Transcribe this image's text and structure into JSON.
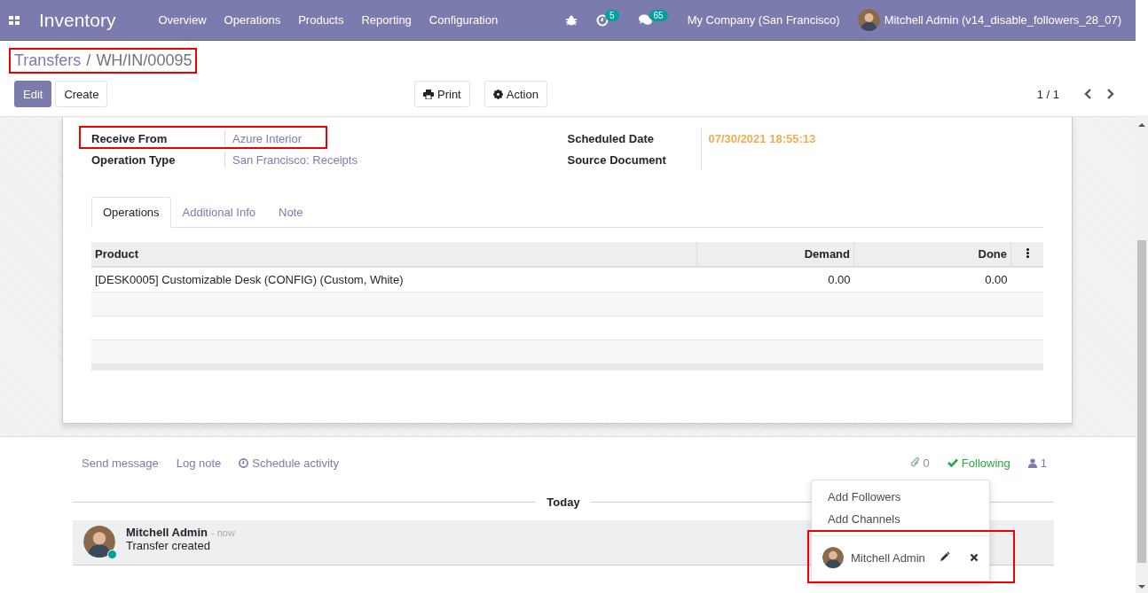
{
  "navbar": {
    "app_name": "Inventory",
    "menu": [
      "Overview",
      "Operations",
      "Products",
      "Reporting",
      "Configuration"
    ],
    "activity_count": "5",
    "message_count": "65",
    "company": "My Company (San Francisco)",
    "user": "Mitchell Admin (v14_disable_followers_28_07)"
  },
  "breadcrumb": {
    "parent": "Transfers",
    "separator": "/",
    "current": "WH/IN/00095",
    "highlighted": true
  },
  "buttons": [
    {
      "label": "Edit",
      "kind": "primary"
    },
    {
      "label": "Create",
      "kind": "secondary"
    }
  ],
  "actions": [
    {
      "label": "Print",
      "kind": "print"
    },
    {
      "label": "Action",
      "kind": "gear"
    }
  ],
  "pager": "1 / 1",
  "form": {
    "left_fields": [
      {
        "label": "Receive From",
        "value": "Azure Interior",
        "highlighted": true
      },
      {
        "label": "Operation Type",
        "value": "San Francisco: Receipts",
        "highlighted": false
      }
    ],
    "right_fields": [
      {
        "label": "Scheduled Date",
        "value": "07/30/2021 18:55:13"
      },
      {
        "label": "Source Document"
      }
    ],
    "tabs": [
      {
        "label": "Operations",
        "selected": true
      },
      {
        "label": "Additional Info",
        "selected": false
      },
      {
        "label": "Note",
        "selected": false
      }
    ],
    "table": {
      "columns": [
        "Product",
        "Demand",
        "Done"
      ],
      "rows": [
        [
          "[DESK0005] Customizable Desk (CONFIG) (Custom, White)",
          "0.00",
          "0.00"
        ]
      ]
    }
  },
  "chatter": {
    "actions": [
      {
        "label": "Send message",
        "kind": "text"
      },
      {
        "label": "Log note",
        "kind": "text"
      },
      {
        "label": "Schedule activity",
        "kind": "clock"
      }
    ],
    "attachments": "0",
    "follow_label": "Following",
    "followers_count": "1",
    "date_separator": "Today",
    "messages": [
      {
        "author": "Mitchell Admin",
        "time": "- now",
        "body": "Transfer created",
        "online": true
      }
    ],
    "followers_menu": {
      "items": [
        "Add Followers",
        "Add Channels"
      ],
      "followers": [
        {
          "name": "Mitchell Admin",
          "highlighted": true
        }
      ]
    }
  }
}
